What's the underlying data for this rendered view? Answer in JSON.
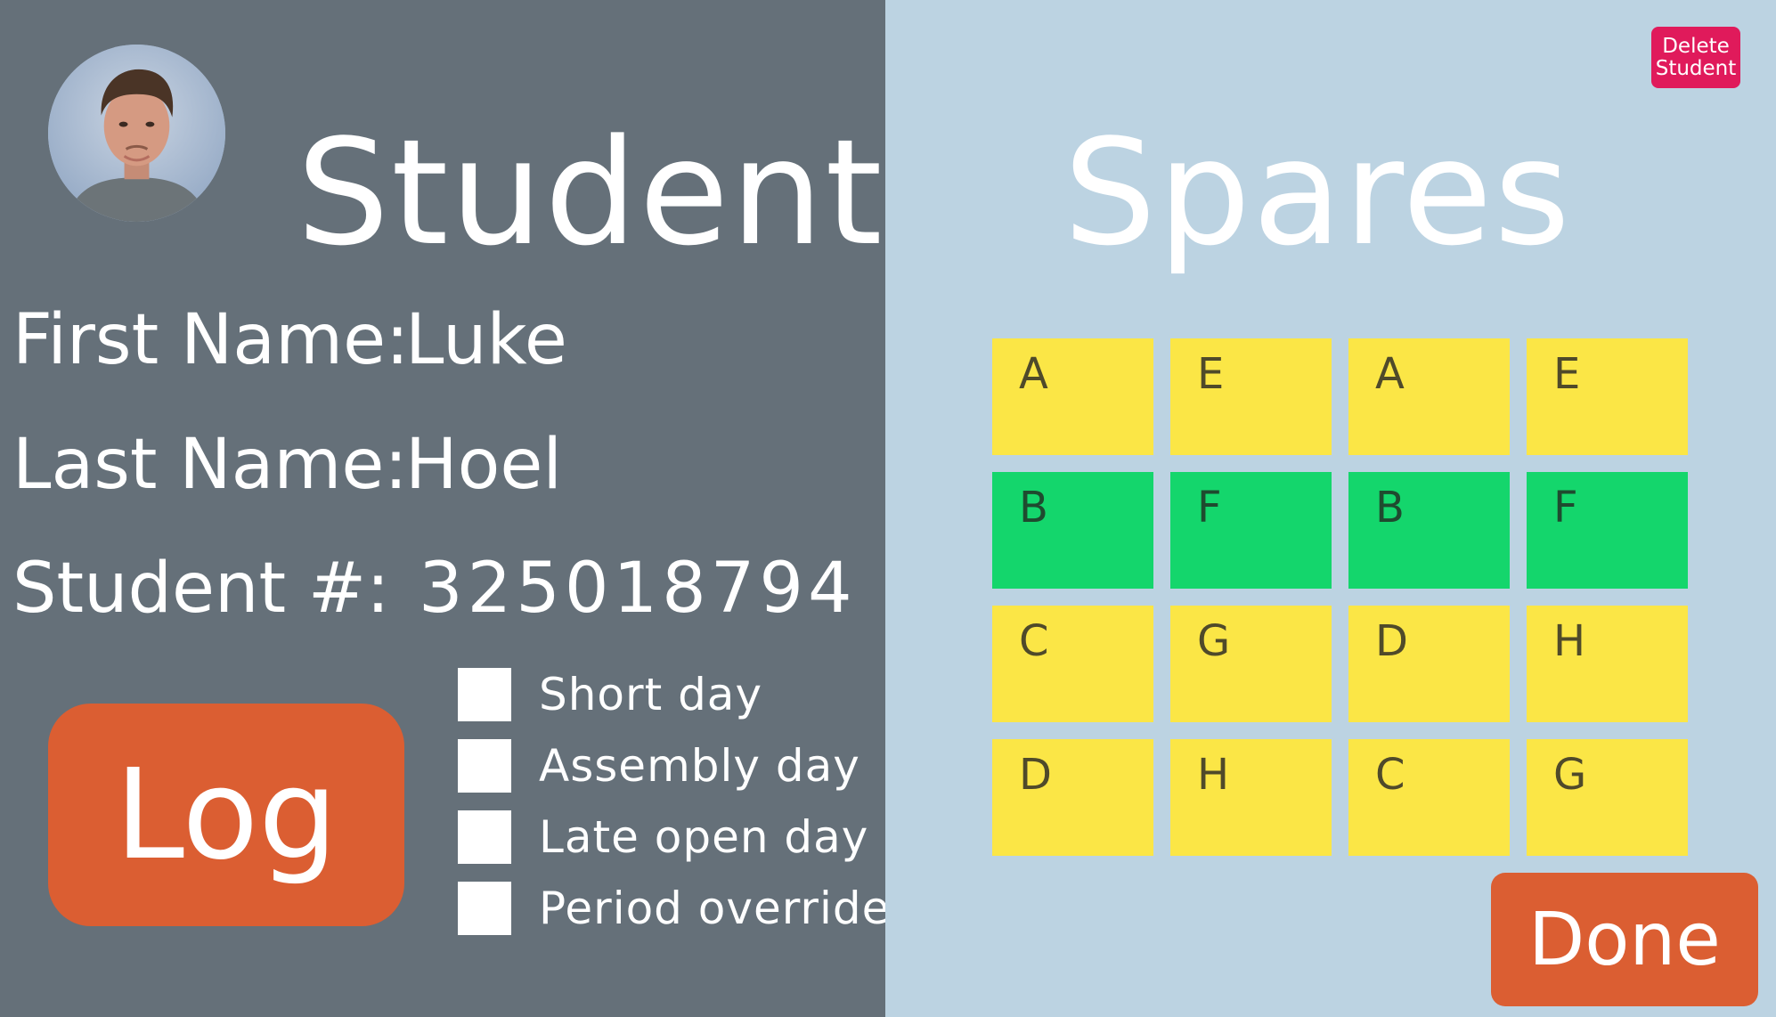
{
  "colors": {
    "left_panel_bg": "#657079",
    "right_panel_bg": "#bcd3e2",
    "button_orange": "#db5e32",
    "delete_red": "#e01a5b",
    "cell_yellow": "#fbe646",
    "cell_green": "#14d66c"
  },
  "student_panel": {
    "title": "Student",
    "avatar": "student-photo",
    "first_name": {
      "label": "First Name:",
      "value": "Luke"
    },
    "last_name": {
      "label": "Last Name:",
      "value": "Hoel"
    },
    "student_number": {
      "label": "Student #:",
      "value": "325018794"
    },
    "log_label": "Log",
    "checkboxes": [
      {
        "label": "Short day",
        "checked": false
      },
      {
        "label": "Assembly day",
        "checked": false
      },
      {
        "label": "Late open day",
        "checked": false
      },
      {
        "label": "Period override",
        "checked": false
      }
    ]
  },
  "spares_panel": {
    "title": "Spares",
    "delete_label_line1": "Delete",
    "delete_label_line2": "Student",
    "done_label": "Done",
    "grid": [
      [
        {
          "label": "A",
          "color": "yellow"
        },
        {
          "label": "E",
          "color": "yellow"
        },
        {
          "label": "A",
          "color": "yellow"
        },
        {
          "label": "E",
          "color": "yellow"
        }
      ],
      [
        {
          "label": "B",
          "color": "green"
        },
        {
          "label": "F",
          "color": "green"
        },
        {
          "label": "B",
          "color": "green"
        },
        {
          "label": "F",
          "color": "green"
        }
      ],
      [
        {
          "label": "C",
          "color": "yellow"
        },
        {
          "label": "G",
          "color": "yellow"
        },
        {
          "label": "D",
          "color": "yellow"
        },
        {
          "label": "H",
          "color": "yellow"
        }
      ],
      [
        {
          "label": "D",
          "color": "yellow"
        },
        {
          "label": "H",
          "color": "yellow"
        },
        {
          "label": "C",
          "color": "yellow"
        },
        {
          "label": "G",
          "color": "yellow"
        }
      ]
    ]
  }
}
